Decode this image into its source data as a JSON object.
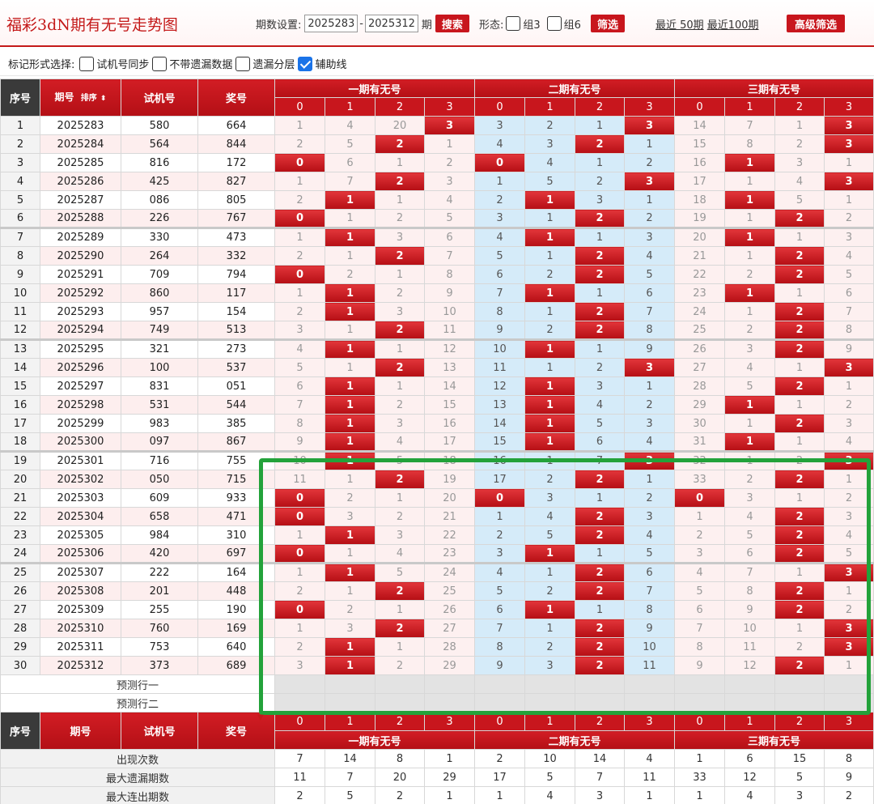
{
  "app": {
    "title": "福彩3dN期有无号走势图"
  },
  "controls": {
    "period_label": "期数设置:",
    "period_from": "2025283",
    "dash": "-",
    "period_to": "2025312",
    "period_suffix": "期",
    "search_label": "搜索",
    "shape_label": "形态:",
    "group3_label": "组3",
    "group6_label": "组6",
    "filter_label": "筛选",
    "recent50": "最近 50期",
    "recent100": "最近100期",
    "advanced_label": "高级筛选"
  },
  "marks": {
    "label": "标记形式选择:",
    "options": [
      {
        "label": "试机号同步",
        "checked": false
      },
      {
        "label": "不带遗漏数据",
        "checked": false
      },
      {
        "label": "遗漏分层",
        "checked": false
      },
      {
        "label": "辅助线",
        "checked": true
      }
    ]
  },
  "table": {
    "headers": {
      "seq": "序号",
      "period": "期号",
      "sort": "排序",
      "test": "试机号",
      "draw": "奖号"
    },
    "groups": [
      "一期有无号",
      "二期有无号",
      "三期有无号"
    ],
    "digits": [
      "0",
      "1",
      "2",
      "3"
    ],
    "rows": [
      {
        "seq": "1",
        "period": "2025283",
        "test": "580",
        "draw": "664",
        "cells": [
          "1",
          "4",
          "20",
          "3",
          "3",
          "2",
          "1",
          "3",
          "14",
          "7",
          "1",
          "3"
        ],
        "hits": [
          3,
          7,
          11
        ]
      },
      {
        "seq": "2",
        "period": "2025284",
        "test": "564",
        "draw": "844",
        "cells": [
          "2",
          "5",
          "2",
          "1",
          "4",
          "3",
          "2",
          "1",
          "15",
          "8",
          "2",
          "3"
        ],
        "hits": [
          2,
          6,
          11
        ]
      },
      {
        "seq": "3",
        "period": "2025285",
        "test": "816",
        "draw": "172",
        "cells": [
          "0",
          "6",
          "1",
          "2",
          "0",
          "4",
          "1",
          "2",
          "16",
          "1",
          "3",
          "1"
        ],
        "hits": [
          0,
          4,
          9
        ]
      },
      {
        "seq": "4",
        "period": "2025286",
        "test": "425",
        "draw": "827",
        "cells": [
          "1",
          "7",
          "2",
          "3",
          "1",
          "5",
          "2",
          "3",
          "17",
          "1",
          "4",
          "3"
        ],
        "hits": [
          2,
          7,
          11
        ]
      },
      {
        "seq": "5",
        "period": "2025287",
        "test": "086",
        "draw": "805",
        "cells": [
          "2",
          "1",
          "1",
          "4",
          "2",
          "1",
          "3",
          "1",
          "18",
          "1",
          "5",
          "1"
        ],
        "hits": [
          1,
          5,
          9
        ]
      },
      {
        "seq": "6",
        "period": "2025288",
        "test": "226",
        "draw": "767",
        "cells": [
          "0",
          "1",
          "2",
          "5",
          "3",
          "1",
          "2",
          "2",
          "19",
          "1",
          "2",
          "2"
        ],
        "hits": [
          0,
          6,
          10
        ]
      },
      {
        "seq": "7",
        "period": "2025289",
        "test": "330",
        "draw": "473",
        "cells": [
          "1",
          "1",
          "3",
          "6",
          "4",
          "1",
          "1",
          "3",
          "20",
          "1",
          "1",
          "3"
        ],
        "hits": [
          1,
          5,
          9
        ]
      },
      {
        "seq": "8",
        "period": "2025290",
        "test": "264",
        "draw": "332",
        "cells": [
          "2",
          "1",
          "2",
          "7",
          "5",
          "1",
          "2",
          "4",
          "21",
          "1",
          "2",
          "4"
        ],
        "hits": [
          2,
          6,
          10
        ]
      },
      {
        "seq": "9",
        "period": "2025291",
        "test": "709",
        "draw": "794",
        "cells": [
          "0",
          "2",
          "1",
          "8",
          "6",
          "2",
          "2",
          "5",
          "22",
          "2",
          "2",
          "5"
        ],
        "hits": [
          0,
          6,
          10
        ]
      },
      {
        "seq": "10",
        "period": "2025292",
        "test": "860",
        "draw": "117",
        "cells": [
          "1",
          "1",
          "2",
          "9",
          "7",
          "1",
          "1",
          "6",
          "23",
          "1",
          "1",
          "6"
        ],
        "hits": [
          1,
          5,
          9
        ]
      },
      {
        "seq": "11",
        "period": "2025293",
        "test": "957",
        "draw": "154",
        "cells": [
          "2",
          "1",
          "3",
          "10",
          "8",
          "1",
          "2",
          "7",
          "24",
          "1",
          "2",
          "7"
        ],
        "hits": [
          1,
          6,
          10
        ]
      },
      {
        "seq": "12",
        "period": "2025294",
        "test": "749",
        "draw": "513",
        "cells": [
          "3",
          "1",
          "2",
          "11",
          "9",
          "2",
          "2",
          "8",
          "25",
          "2",
          "2",
          "8"
        ],
        "hits": [
          2,
          6,
          10
        ]
      },
      {
        "seq": "13",
        "period": "2025295",
        "test": "321",
        "draw": "273",
        "cells": [
          "4",
          "1",
          "1",
          "12",
          "10",
          "1",
          "1",
          "9",
          "26",
          "3",
          "2",
          "9"
        ],
        "hits": [
          1,
          5,
          10
        ]
      },
      {
        "seq": "14",
        "period": "2025296",
        "test": "100",
        "draw": "537",
        "cells": [
          "5",
          "1",
          "2",
          "13",
          "11",
          "1",
          "2",
          "3",
          "27",
          "4",
          "1",
          "3"
        ],
        "hits": [
          2,
          7,
          11
        ]
      },
      {
        "seq": "15",
        "period": "2025297",
        "test": "831",
        "draw": "051",
        "cells": [
          "6",
          "1",
          "1",
          "14",
          "12",
          "1",
          "3",
          "1",
          "28",
          "5",
          "2",
          "1"
        ],
        "hits": [
          1,
          5,
          10
        ]
      },
      {
        "seq": "16",
        "period": "2025298",
        "test": "531",
        "draw": "544",
        "cells": [
          "7",
          "1",
          "2",
          "15",
          "13",
          "1",
          "4",
          "2",
          "29",
          "1",
          "1",
          "2"
        ],
        "hits": [
          1,
          5,
          9
        ]
      },
      {
        "seq": "17",
        "period": "2025299",
        "test": "983",
        "draw": "385",
        "cells": [
          "8",
          "1",
          "3",
          "16",
          "14",
          "1",
          "5",
          "3",
          "30",
          "1",
          "2",
          "3"
        ],
        "hits": [
          1,
          5,
          10
        ]
      },
      {
        "seq": "18",
        "period": "2025300",
        "test": "097",
        "draw": "867",
        "cells": [
          "9",
          "1",
          "4",
          "17",
          "15",
          "1",
          "6",
          "4",
          "31",
          "1",
          "1",
          "4"
        ],
        "hits": [
          1,
          5,
          9
        ]
      },
      {
        "seq": "19",
        "period": "2025301",
        "test": "716",
        "draw": "755",
        "cells": [
          "10",
          "1",
          "5",
          "18",
          "16",
          "1",
          "7",
          "3",
          "32",
          "1",
          "2",
          "3"
        ],
        "hits": [
          1,
          7,
          11
        ]
      },
      {
        "seq": "20",
        "period": "2025302",
        "test": "050",
        "draw": "715",
        "cells": [
          "11",
          "1",
          "2",
          "19",
          "17",
          "2",
          "2",
          "1",
          "33",
          "2",
          "2",
          "1"
        ],
        "hits": [
          2,
          6,
          10
        ]
      },
      {
        "seq": "21",
        "period": "2025303",
        "test": "609",
        "draw": "933",
        "cells": [
          "0",
          "2",
          "1",
          "20",
          "0",
          "3",
          "1",
          "2",
          "0",
          "3",
          "1",
          "2"
        ],
        "hits": [
          0,
          4,
          8
        ]
      },
      {
        "seq": "22",
        "period": "2025304",
        "test": "658",
        "draw": "471",
        "cells": [
          "0",
          "3",
          "2",
          "21",
          "1",
          "4",
          "2",
          "3",
          "1",
          "4",
          "2",
          "3"
        ],
        "hits": [
          0,
          6,
          10
        ]
      },
      {
        "seq": "23",
        "period": "2025305",
        "test": "984",
        "draw": "310",
        "cells": [
          "1",
          "1",
          "3",
          "22",
          "2",
          "5",
          "2",
          "4",
          "2",
          "5",
          "2",
          "4"
        ],
        "hits": [
          1,
          6,
          10
        ]
      },
      {
        "seq": "24",
        "period": "2025306",
        "test": "420",
        "draw": "697",
        "cells": [
          "0",
          "1",
          "4",
          "23",
          "3",
          "1",
          "1",
          "5",
          "3",
          "6",
          "2",
          "5"
        ],
        "hits": [
          0,
          5,
          10
        ]
      },
      {
        "seq": "25",
        "period": "2025307",
        "test": "222",
        "draw": "164",
        "cells": [
          "1",
          "1",
          "5",
          "24",
          "4",
          "1",
          "2",
          "6",
          "4",
          "7",
          "1",
          "3"
        ],
        "hits": [
          1,
          6,
          11
        ]
      },
      {
        "seq": "26",
        "period": "2025308",
        "test": "201",
        "draw": "448",
        "cells": [
          "2",
          "1",
          "2",
          "25",
          "5",
          "2",
          "2",
          "7",
          "5",
          "8",
          "2",
          "1"
        ],
        "hits": [
          2,
          6,
          10
        ]
      },
      {
        "seq": "27",
        "period": "2025309",
        "test": "255",
        "draw": "190",
        "cells": [
          "0",
          "2",
          "1",
          "26",
          "6",
          "1",
          "1",
          "8",
          "6",
          "9",
          "2",
          "2"
        ],
        "hits": [
          0,
          5,
          10
        ]
      },
      {
        "seq": "28",
        "period": "2025310",
        "test": "760",
        "draw": "169",
        "cells": [
          "1",
          "3",
          "2",
          "27",
          "7",
          "1",
          "2",
          "9",
          "7",
          "10",
          "1",
          "3"
        ],
        "hits": [
          2,
          6,
          11
        ]
      },
      {
        "seq": "29",
        "period": "2025311",
        "test": "753",
        "draw": "640",
        "cells": [
          "2",
          "1",
          "1",
          "28",
          "8",
          "2",
          "2",
          "10",
          "8",
          "11",
          "2",
          "3"
        ],
        "hits": [
          1,
          6,
          11
        ]
      },
      {
        "seq": "30",
        "period": "2025312",
        "test": "373",
        "draw": "689",
        "cells": [
          "3",
          "1",
          "2",
          "29",
          "9",
          "3",
          "2",
          "11",
          "9",
          "12",
          "2",
          "1"
        ],
        "hits": [
          1,
          6,
          10
        ]
      }
    ],
    "predict_rows": [
      "预测行一",
      "预测行二"
    ],
    "stats": [
      {
        "label": "出现次数",
        "values": [
          "7",
          "14",
          "8",
          "1",
          "2",
          "10",
          "14",
          "4",
          "1",
          "6",
          "15",
          "8"
        ]
      },
      {
        "label": "最大遗漏期数",
        "values": [
          "11",
          "7",
          "20",
          "29",
          "17",
          "5",
          "7",
          "11",
          "33",
          "12",
          "5",
          "9"
        ]
      },
      {
        "label": "最大连出期数",
        "values": [
          "2",
          "5",
          "2",
          "1",
          "1",
          "4",
          "3",
          "1",
          "1",
          "4",
          "3",
          "2"
        ]
      }
    ]
  },
  "colors": {
    "brand_red": "#c8161d",
    "highlight_green": "#23a23a",
    "blue_zone": "#d5ebf9"
  }
}
